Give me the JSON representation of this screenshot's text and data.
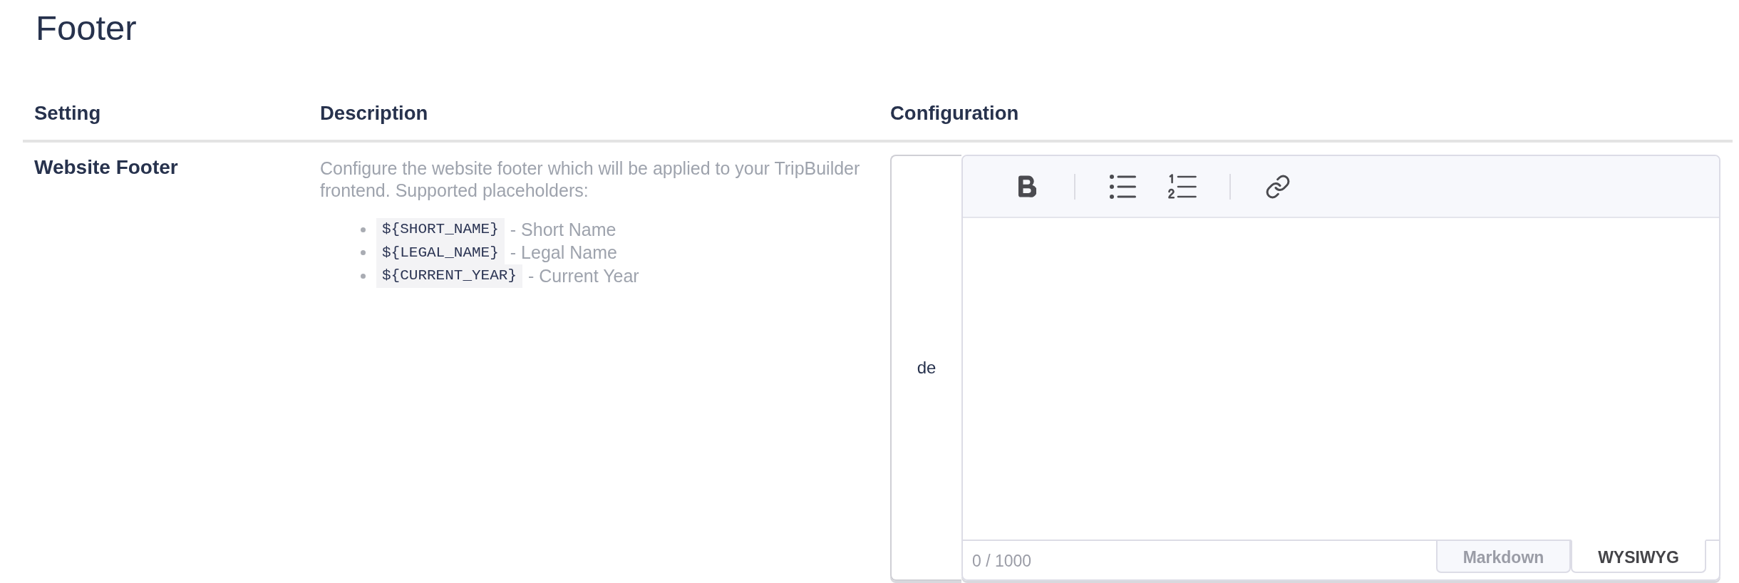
{
  "page": {
    "title": "Footer"
  },
  "table": {
    "columns": [
      "Setting",
      "Description",
      "Configuration"
    ],
    "rows": [
      {
        "setting": "Website Footer",
        "description": {
          "text": "Configure the website footer which will be applied to your TripBuilder frontend. Supported placeholders:",
          "placeholders": [
            {
              "code": "${SHORT_NAME}",
              "label": "- Short Name"
            },
            {
              "code": "${LEGAL_NAME}",
              "label": "- Legal Name"
            },
            {
              "code": "${CURRENT_YEAR}",
              "label": "- Current Year"
            }
          ]
        },
        "configuration": {
          "language": "de",
          "editor": {
            "toolbar": [
              {
                "kind": "bold"
              },
              {
                "kind": "divider"
              },
              {
                "kind": "bullet_list"
              },
              {
                "kind": "numbered_list"
              },
              {
                "kind": "divider"
              },
              {
                "kind": "link"
              }
            ],
            "counter": "0 / 1000",
            "modes": [
              {
                "label": "Markdown",
                "selected": false
              },
              {
                "label": "WYSIWYG",
                "selected": true
              }
            ]
          }
        }
      }
    ]
  }
}
